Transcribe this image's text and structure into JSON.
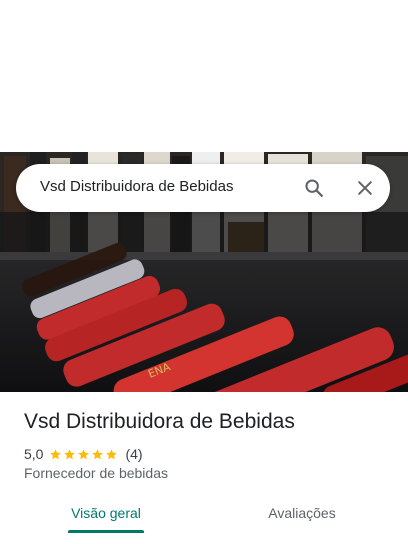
{
  "search": {
    "query": "Vsd Distribuidora de Bebidas",
    "search_icon": "search-icon",
    "close_icon": "close-icon"
  },
  "photo": {
    "label_text": "ENA"
  },
  "place": {
    "title": "Vsd Distribuidora de Bebidas",
    "rating": "5,0",
    "rating_stars": 5,
    "review_count": "(4)",
    "category": "Fornecedor de bebidas"
  },
  "tabs": [
    {
      "label": "Visão geral",
      "active": true
    },
    {
      "label": "Avaliações",
      "active": false
    }
  ],
  "colors": {
    "accent": "#00796b",
    "star": "#fbbc04",
    "text_primary": "#202124",
    "text_secondary": "#5f6368"
  }
}
